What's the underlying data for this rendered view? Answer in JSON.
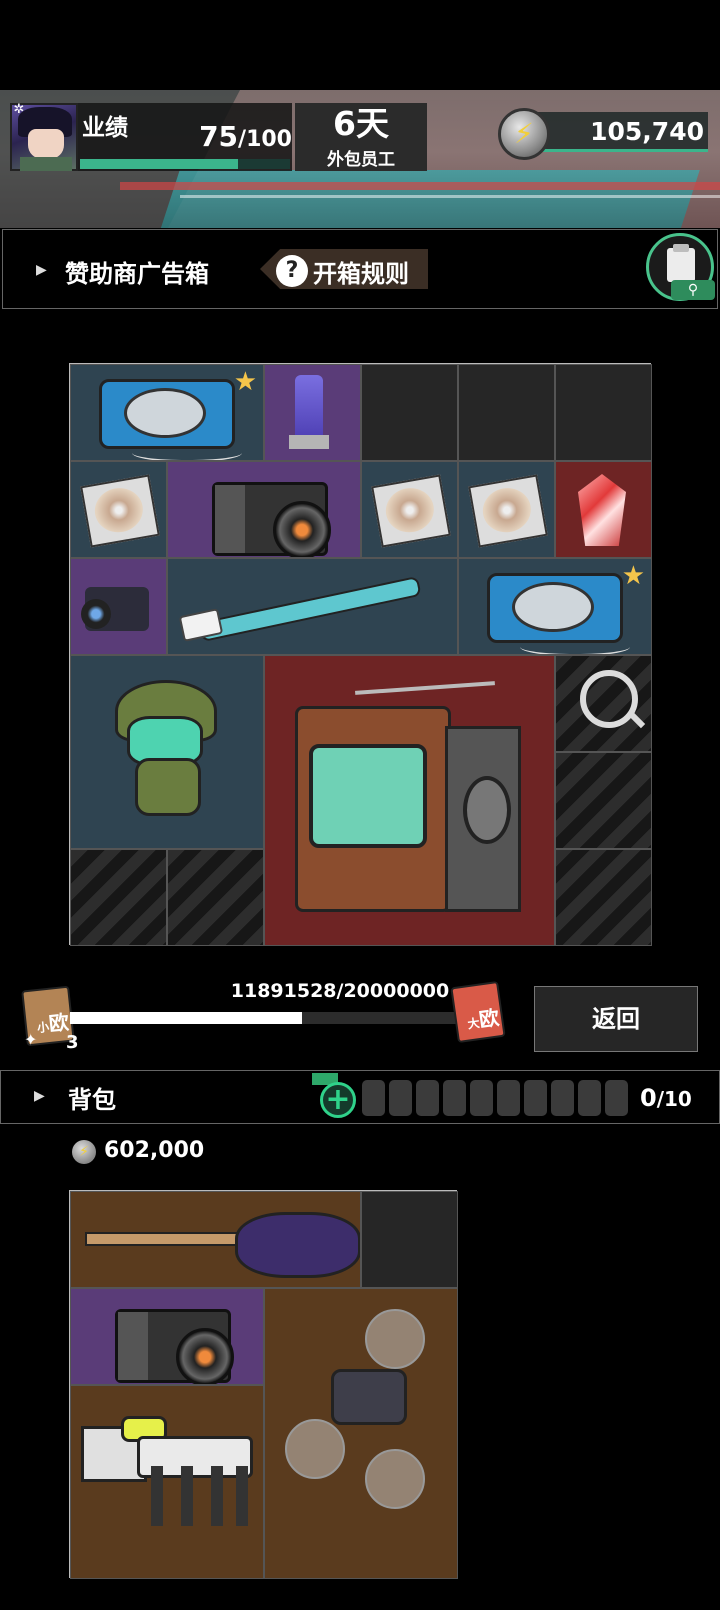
{
  "header": {
    "performance_label": "业绩",
    "performance_current": "75",
    "performance_max": "/100",
    "performance_fraction": 0.75,
    "days_value": "6天",
    "days_label": "外包员工",
    "coins": "105,740"
  },
  "sponsor": {
    "title": "赞助商广告箱",
    "rules_label": "开箱规则",
    "rules_icon": "?"
  },
  "loot_items": [
    {
      "name": "cd-player",
      "color": "blue",
      "starred": true
    },
    {
      "name": "keychain",
      "color": "purple"
    },
    {
      "name": "cd-disc",
      "color": "blue"
    },
    {
      "name": "film-camera",
      "color": "purple"
    },
    {
      "name": "cd-disc",
      "color": "blue"
    },
    {
      "name": "cd-disc",
      "color": "blue"
    },
    {
      "name": "red-gem",
      "color": "red"
    },
    {
      "name": "camcorder",
      "color": "purple"
    },
    {
      "name": "electric-toothbrush",
      "color": "blue"
    },
    {
      "name": "cd-player",
      "color": "blue",
      "starred": true
    },
    {
      "name": "frog-figure",
      "color": "blue"
    },
    {
      "name": "retro-tv",
      "color": "red"
    }
  ],
  "progress": {
    "label": "11891528/20000000",
    "current": 11891528,
    "max": 20000000,
    "small_icon_text": "欧",
    "small_icon_prefix": "小",
    "big_icon_text": "欧",
    "big_icon_prefix": "大",
    "pieces": "3"
  },
  "return_label": "返回",
  "backpack": {
    "title": "背包",
    "capacity_used": "0",
    "capacity_max": "/10",
    "value": "602,000",
    "items": [
      {
        "name": "electric-guitar",
        "color": "brown"
      },
      {
        "name": "film-camera",
        "color": "purple"
      },
      {
        "name": "robot-dog",
        "color": "brown"
      },
      {
        "name": "drone",
        "color": "brown"
      }
    ]
  },
  "colors": {
    "accent_green": "#3bb58c",
    "slot_blue": "#2f4451",
    "slot_purple": "#5a3c78",
    "slot_red": "#6e2424",
    "slot_brown": "#5a3b1e"
  }
}
